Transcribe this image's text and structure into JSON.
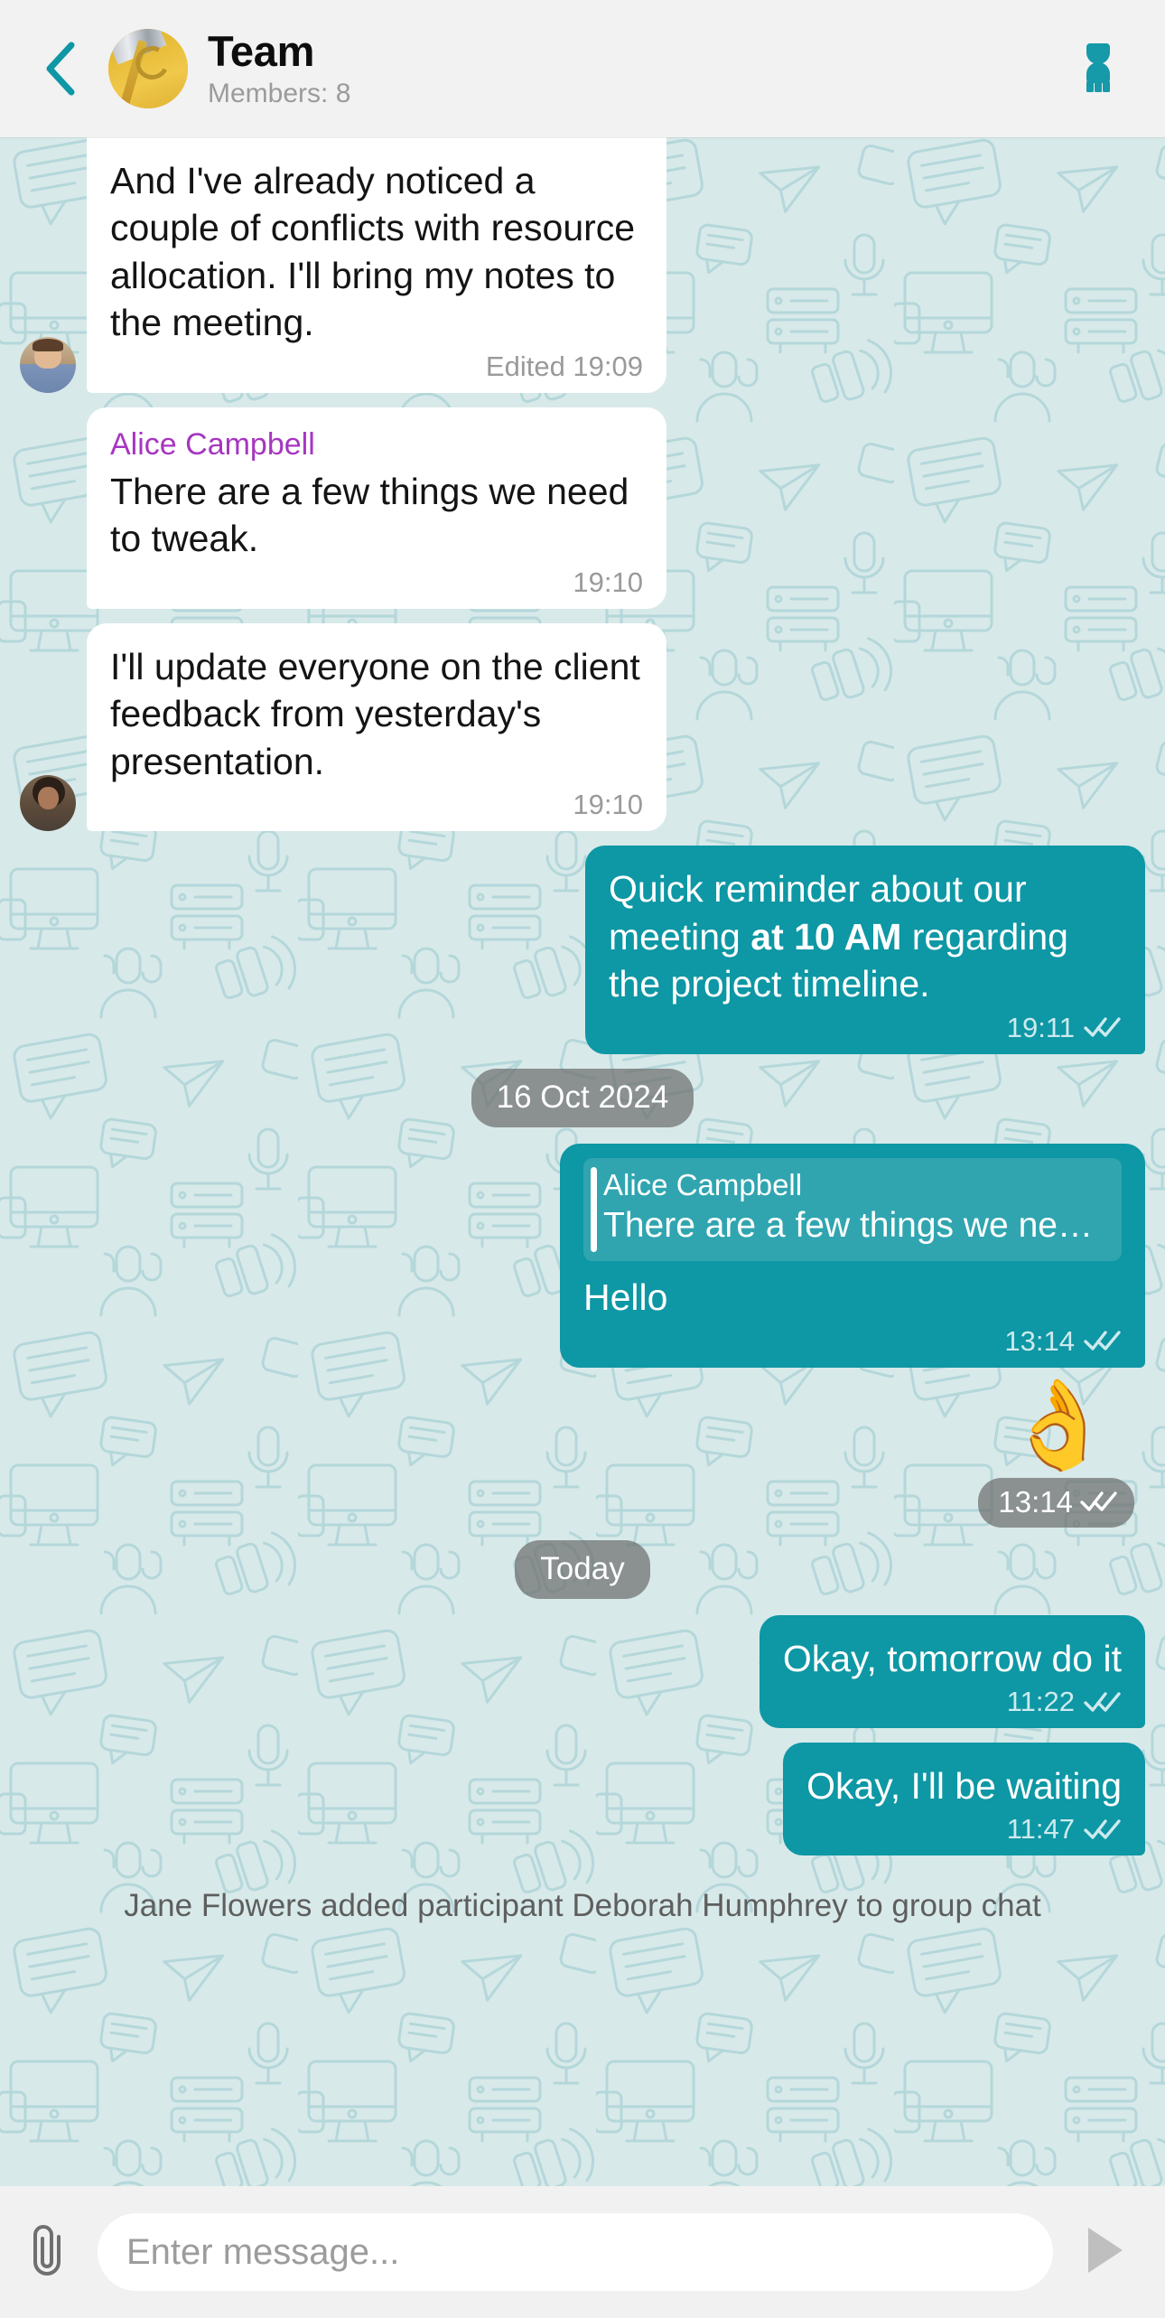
{
  "header": {
    "back_icon": "chevron-left-icon",
    "title": "Team",
    "subtitle": "Members: 8",
    "avatar_icon": "group-avatar",
    "action_icon": "group-members-icon",
    "accent_color": "#0e97a4",
    "bg_color": "#f2f2f2"
  },
  "chat": {
    "background_color": "#d8e9e9",
    "pattern_color": "#bcdbdd",
    "sender_name_color": "#a636c0",
    "outgoing_bubble_color": "#0e97a4",
    "incoming_bubble_color": "#ffffff",
    "messages": [
      {
        "id": "m1",
        "direction": "in",
        "avatar": "avatar-man",
        "sender": null,
        "text": "And I've already noticed a couple of conflicts with resource allocation. I'll bring my notes to the meeting.",
        "time": "Edited 19:09",
        "status": null,
        "clipped_top": true
      },
      {
        "id": "m2",
        "direction": "in",
        "avatar": null,
        "sender": "Alice Campbell",
        "text": "There are a few things we need to tweak.",
        "time": "19:10",
        "status": null
      },
      {
        "id": "m3",
        "direction": "in",
        "avatar": "avatar-woman",
        "sender": null,
        "text": "I'll update everyone on the client feedback from yesterday's presentation.",
        "time": "19:10",
        "status": null
      },
      {
        "id": "m4",
        "direction": "out",
        "text_parts": [
          {
            "text": "Quick reminder about our meeting ",
            "bold": false
          },
          {
            "text": "at 10 AM",
            "bold": true
          },
          {
            "text": " regarding the project timeline.",
            "bold": false
          }
        ],
        "time": "19:11",
        "status": "read"
      }
    ],
    "divider_1": "16 Oct 2024",
    "reply_message": {
      "id": "m5",
      "direction": "out",
      "quote_sender": "Alice Campbell",
      "quote_text": "There are a few things we need to tw…",
      "text": "Hello",
      "time": "13:14",
      "status": "read"
    },
    "sticker_message": {
      "id": "m6",
      "direction": "out",
      "emoji": "👌",
      "emoji_name": "ok-hand-emoji",
      "time": "13:14",
      "status": "read"
    },
    "divider_2": "Today",
    "messages_today": [
      {
        "id": "m7",
        "direction": "out",
        "text": "Okay, tomorrow do it",
        "time": "11:22",
        "status": "read"
      },
      {
        "id": "m8",
        "direction": "out",
        "text": "Okay, I'll be waiting",
        "time": "11:47",
        "status": "read"
      }
    ],
    "system_notice": "Jane Flowers added participant Deborah Humphrey to group chat"
  },
  "composer": {
    "attach_icon": "paperclip-icon",
    "placeholder": "Enter message...",
    "value": "",
    "send_icon": "send-arrow-icon",
    "send_color": "#bfbfbf"
  }
}
